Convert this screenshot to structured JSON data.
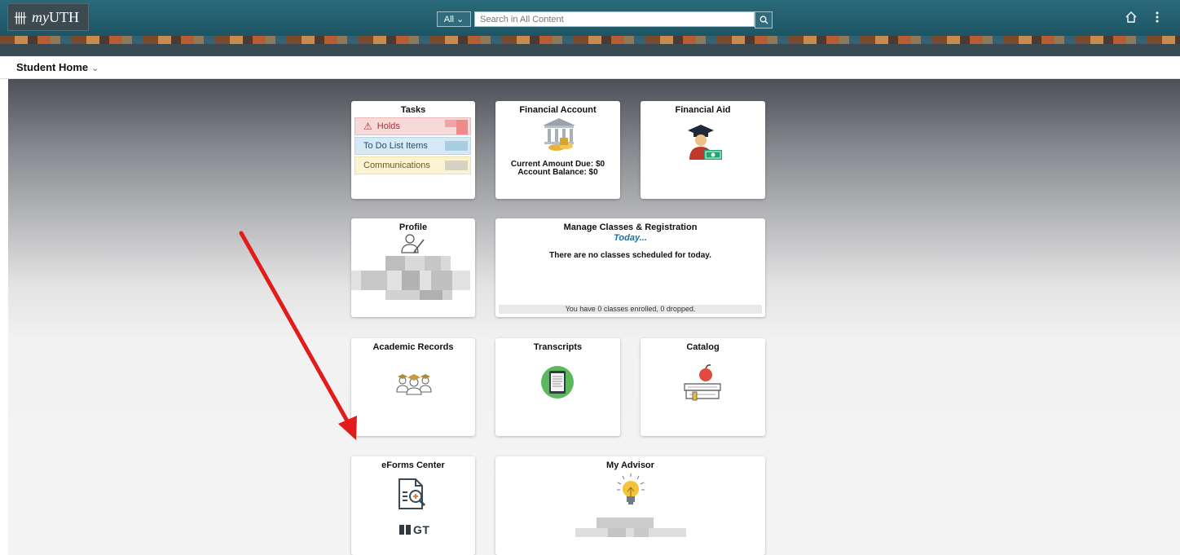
{
  "header": {
    "logo_grid": "卌",
    "logo_my": "my",
    "logo_uth": "UTH",
    "search_scope": "All ⌄",
    "search_placeholder": "Search in All Content",
    "search_icon": "search-icon",
    "home_icon": "home-icon",
    "menu_icon": "more-vertical-icon"
  },
  "nav": {
    "page_title": "Student Home",
    "page_chev": "⌄"
  },
  "tiles": {
    "tasks": {
      "title": "Tasks",
      "holds": "Holds",
      "holds_icon": "⚠",
      "todo": "To Do List Items",
      "comms": "Communications"
    },
    "financial_account": {
      "title": "Financial Account",
      "amount_due": "Current Amount Due: $0",
      "balance": "Account Balance: $0"
    },
    "financial_aid": {
      "title": "Financial Aid"
    },
    "profile": {
      "title": "Profile"
    },
    "manage_classes": {
      "title": "Manage Classes & Registration",
      "today": "Today...",
      "no_classes": "There are no classes scheduled for today.",
      "enrolled_summary": "You have 0 classes enrolled,  0 dropped."
    },
    "academic_records": {
      "title": "Academic Records"
    },
    "transcripts": {
      "title": "Transcripts"
    },
    "catalog": {
      "title": "Catalog"
    },
    "eforms": {
      "title": "eForms Center",
      "logo_text": "GT"
    },
    "my_advisor": {
      "title": "My Advisor"
    }
  },
  "colors": {
    "header_teal": "#1d5564",
    "holds_red": "#c0392b",
    "today_blue": "#1f6fa8",
    "arrow_red": "#e21b1b"
  }
}
